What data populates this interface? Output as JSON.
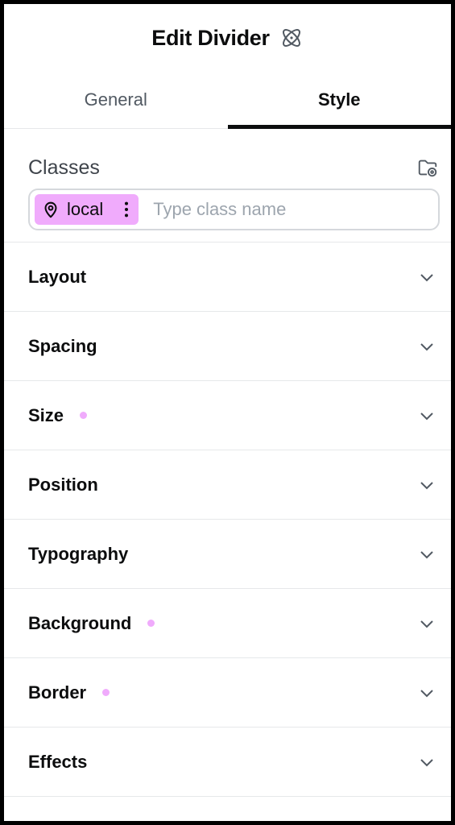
{
  "header": {
    "title": "Edit Divider",
    "icon": "atom-icon"
  },
  "tabs": [
    {
      "label": "General",
      "active": false
    },
    {
      "label": "Style",
      "active": true
    }
  ],
  "classes": {
    "label": "Classes",
    "manager_icon": "folder-settings-icon",
    "chip": {
      "label": "local",
      "icon": "map-pin-icon",
      "color": "#f0abfc"
    },
    "input_placeholder": "Type class name",
    "input_value": ""
  },
  "sections": [
    {
      "label": "Layout",
      "modified": false
    },
    {
      "label": "Spacing",
      "modified": false
    },
    {
      "label": "Size",
      "modified": true
    },
    {
      "label": "Position",
      "modified": false
    },
    {
      "label": "Typography",
      "modified": false
    },
    {
      "label": "Background",
      "modified": true
    },
    {
      "label": "Border",
      "modified": true
    },
    {
      "label": "Effects",
      "modified": false
    }
  ],
  "colors": {
    "accent": "#f0abfc",
    "text": "#0c0d0e",
    "border": "#e6e8ea"
  }
}
